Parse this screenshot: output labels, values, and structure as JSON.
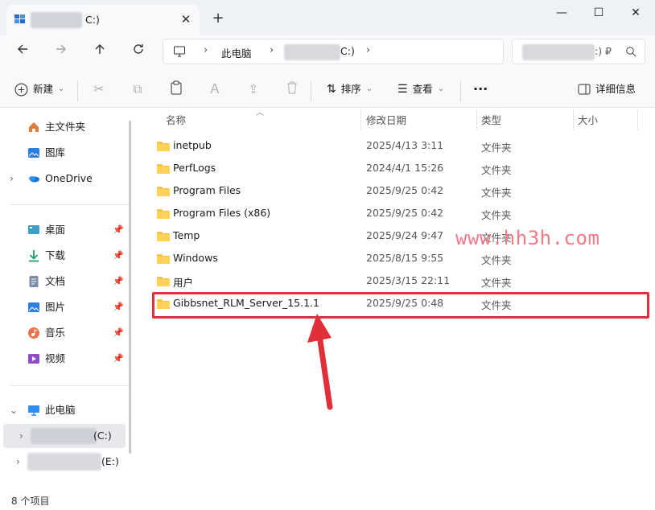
{
  "window": {
    "tab_title": "C:)",
    "minimize": "—",
    "maximize": "☐",
    "close": "✕",
    "new_tab": "+"
  },
  "address": {
    "crumb_this_pc": "此电脑",
    "crumb_drive": "C:)",
    "separator": "›"
  },
  "search": {
    "placeholder_tail": ":) ₽"
  },
  "toolbar": {
    "new_label": "新建",
    "sort_label": "排序",
    "view_label": "查看",
    "more": "···",
    "details_label": "详细信息"
  },
  "sidebar": {
    "quick": [
      {
        "label": "主文件夹",
        "icon": "home-icon"
      },
      {
        "label": "图库",
        "icon": "gallery-icon"
      },
      {
        "label": "OneDrive",
        "icon": "onedrive-icon"
      }
    ],
    "pinned": [
      {
        "label": "桌面",
        "icon": "desktop-icon"
      },
      {
        "label": "下载",
        "icon": "download-icon"
      },
      {
        "label": "文档",
        "icon": "document-icon"
      },
      {
        "label": "图片",
        "icon": "pictures-icon"
      },
      {
        "label": "音乐",
        "icon": "music-icon"
      },
      {
        "label": "视频",
        "icon": "video-icon"
      }
    ],
    "this_pc": "此电脑",
    "drive_c": "(C:)",
    "drive_e": "(E:)"
  },
  "columns": {
    "name": "名称",
    "modified": "修改日期",
    "type": "类型",
    "size": "大小"
  },
  "files": [
    {
      "name": "inetpub",
      "modified": "2025/4/13 3:11",
      "type": "文件夹"
    },
    {
      "name": "PerfLogs",
      "modified": "2024/4/1 15:26",
      "type": "文件夹"
    },
    {
      "name": "Program Files",
      "modified": "2025/9/25 0:42",
      "type": "文件夹"
    },
    {
      "name": "Program Files (x86)",
      "modified": "2025/9/25 0:42",
      "type": "文件夹"
    },
    {
      "name": "Temp",
      "modified": "2025/9/24 9:47",
      "type": "文件夹"
    },
    {
      "name": "Windows",
      "modified": "2025/8/15 9:55",
      "type": "文件夹"
    },
    {
      "name": "用户",
      "modified": "2025/3/15 22:11",
      "type": "文件夹"
    },
    {
      "name": "Gibbsnet_RLM_Server_15.1.1",
      "modified": "2025/9/25 0:48",
      "type": "文件夹"
    }
  ],
  "watermark": "www.hh3h.com",
  "status": "8 个项目",
  "colors": {
    "accent": "#0067c0",
    "highlight": "#e02f38",
    "folder": "#f6c443"
  }
}
